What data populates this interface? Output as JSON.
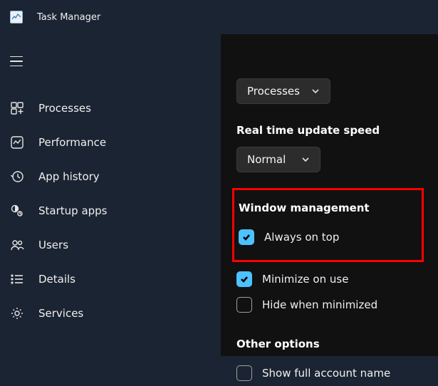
{
  "app": {
    "title": "Task Manager"
  },
  "nav": {
    "items": [
      {
        "label": "Processes"
      },
      {
        "label": "Performance"
      },
      {
        "label": "App history"
      },
      {
        "label": "Startup apps"
      },
      {
        "label": "Users"
      },
      {
        "label": "Details"
      },
      {
        "label": "Services"
      }
    ]
  },
  "settings": {
    "default_page": {
      "value": "Processes"
    },
    "update_speed": {
      "heading": "Real time update speed",
      "value": "Normal"
    },
    "window_mgmt": {
      "heading": "Window management",
      "always_on_top": {
        "label": "Always on top",
        "checked": true
      },
      "minimize_on_use": {
        "label": "Minimize on use",
        "checked": true
      },
      "hide_when_minimized": {
        "label": "Hide when minimized",
        "checked": false
      }
    },
    "other": {
      "heading": "Other options",
      "show_full_account": {
        "label": "Show full account name",
        "checked": false
      }
    }
  }
}
